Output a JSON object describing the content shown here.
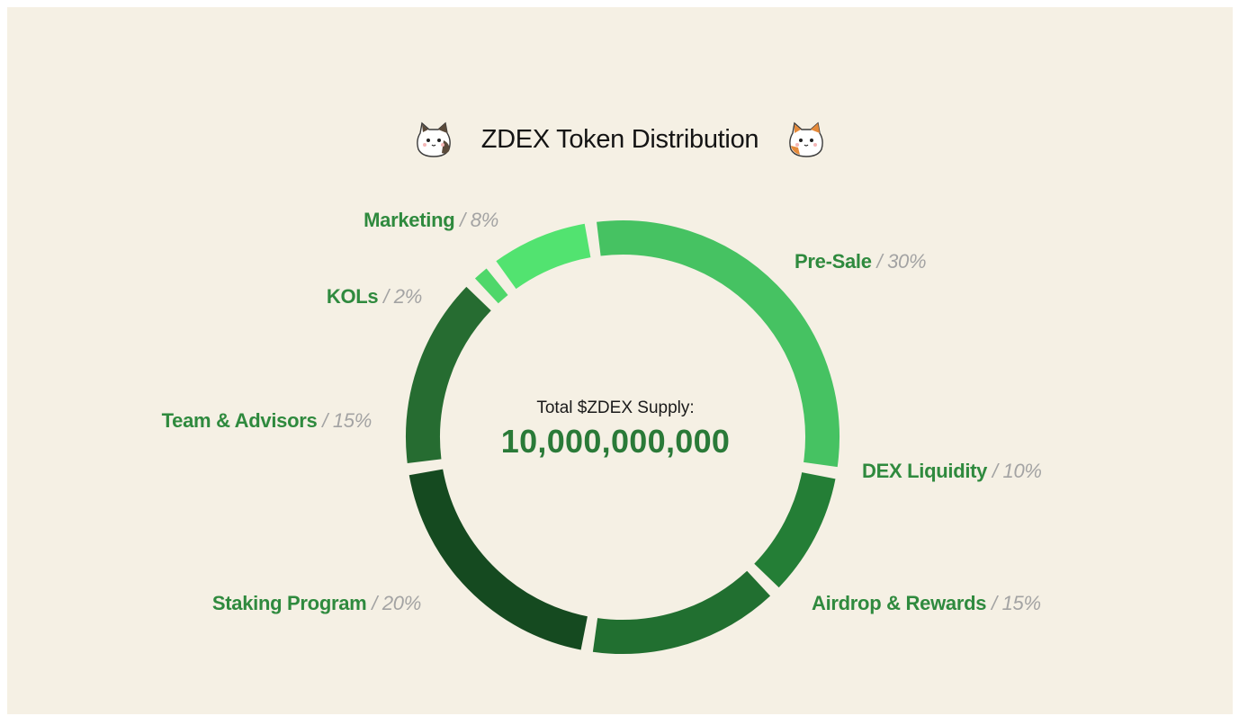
{
  "title": "ZDEX Token Distribution",
  "icons": [
    "cat-icon",
    "cat-icon"
  ],
  "center": {
    "caption": "Total $ZDEX Supply:",
    "value": "10,000,000,000"
  },
  "chart_data": {
    "type": "pie",
    "title": "ZDEX Token Distribution",
    "categories": [
      "Pre-Sale",
      "DEX Liquidity",
      "Airdrop & Rewards",
      "Staking Program",
      "Team & Advisors",
      "KOLs",
      "Marketing"
    ],
    "values": [
      30,
      10,
      15,
      20,
      15,
      2,
      8
    ],
    "value_labels": [
      "30%",
      "10%",
      "15%",
      "20%",
      "15%",
      "2%",
      "8%"
    ],
    "colors": [
      "#46c262",
      "#247e36",
      "#216f30",
      "#154a20",
      "#266c31",
      "#4ed76a",
      "#52e370"
    ],
    "legend": "none"
  }
}
